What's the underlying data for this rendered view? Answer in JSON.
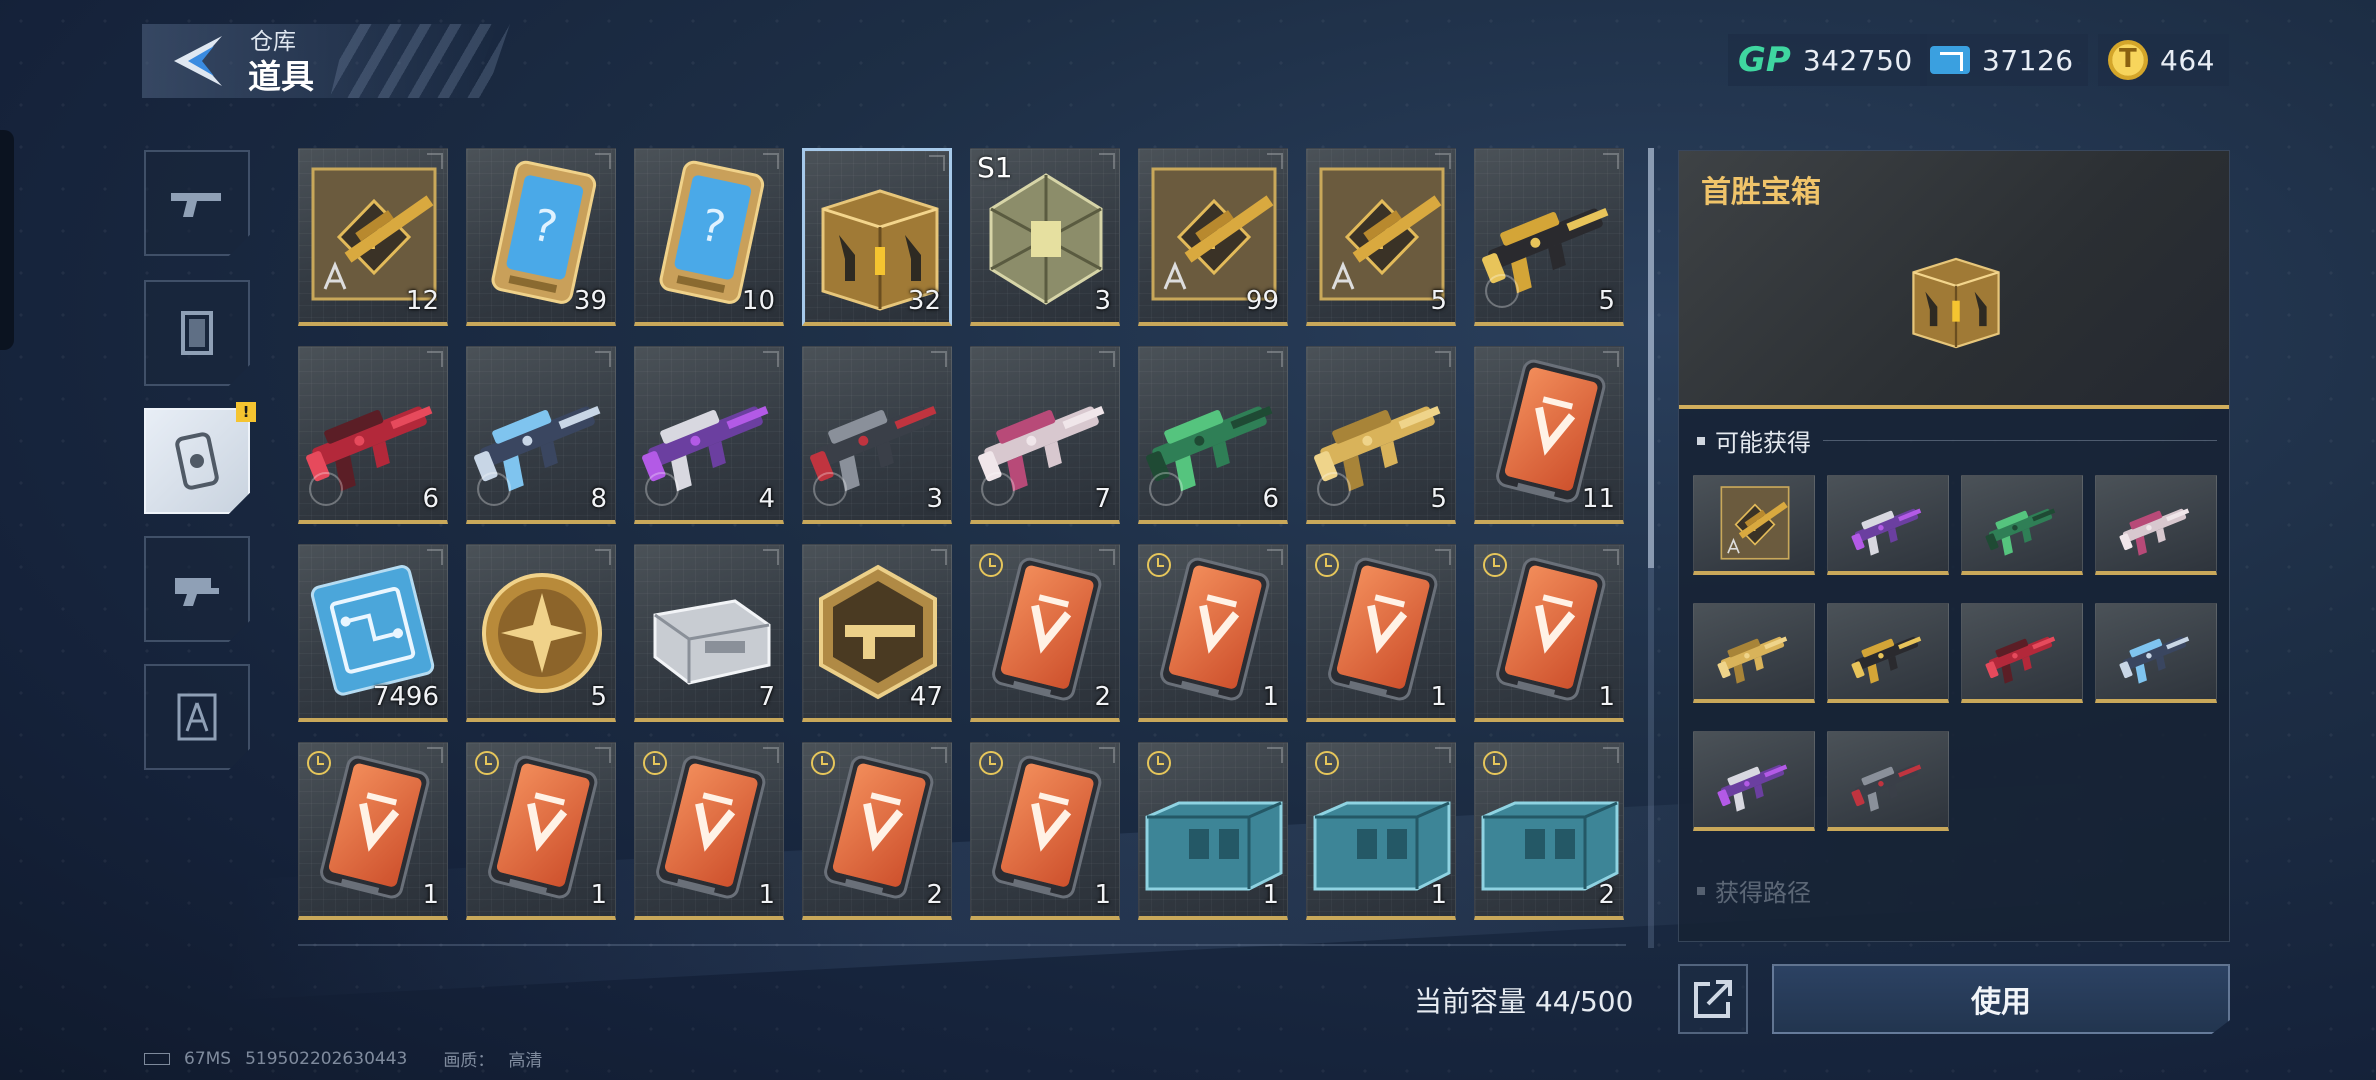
{
  "header": {
    "breadcrumb_parent": "仓库",
    "title": "道具"
  },
  "currencies": [
    {
      "icon": "gp-currency-icon",
      "label": "GP",
      "value": "342750"
    },
    {
      "icon": "ticket-currency-icon",
      "value": "37126"
    },
    {
      "icon": "gold-coin-icon",
      "value": "464"
    }
  ],
  "categories": [
    {
      "name": "weapons",
      "icon": "gun-icon",
      "active": false
    },
    {
      "name": "frames",
      "icon": "frame-icon",
      "active": false
    },
    {
      "name": "items",
      "icon": "item-card-icon",
      "active": true,
      "badge": "!"
    },
    {
      "name": "attachments",
      "icon": "gun-part-icon",
      "active": false
    },
    {
      "name": "blueprints",
      "icon": "blueprint-icon",
      "active": false
    }
  ],
  "items": [
    {
      "art": "blueprint-crate",
      "count": "12"
    },
    {
      "art": "mystery-card",
      "count": "39"
    },
    {
      "art": "mystery-card",
      "count": "10"
    },
    {
      "art": "gold-chest",
      "count": "32",
      "selected": true
    },
    {
      "art": "season-chest",
      "count": "3",
      "tag": "S1"
    },
    {
      "art": "blueprint-crate",
      "count": "99"
    },
    {
      "art": "blueprint-crate",
      "count": "5"
    },
    {
      "art": "rifle-black-gold",
      "count": "5",
      "timer_dim": true
    },
    {
      "art": "rifle-red",
      "count": "6",
      "timer_dim": true
    },
    {
      "art": "rifle-blue",
      "count": "8",
      "timer_dim": true
    },
    {
      "art": "rifle-purple",
      "count": "4",
      "timer_dim": true
    },
    {
      "art": "rifle-dark",
      "count": "3",
      "timer_dim": true
    },
    {
      "art": "rifle-pink",
      "count": "7",
      "timer_dim": true
    },
    {
      "art": "rifle-green",
      "count": "6",
      "timer_dim": true
    },
    {
      "art": "rifle-gold",
      "count": "5",
      "timer_dim": true
    },
    {
      "art": "orange-card",
      "count": "11"
    },
    {
      "art": "chip-card",
      "count": "7496"
    },
    {
      "art": "gold-medal",
      "count": "5"
    },
    {
      "art": "silver-case",
      "count": "7"
    },
    {
      "art": "hex-badge",
      "count": "47"
    },
    {
      "art": "orange-card",
      "count": "2",
      "timer": true
    },
    {
      "art": "orange-card",
      "count": "1",
      "timer": true
    },
    {
      "art": "orange-card",
      "count": "1",
      "timer": true
    },
    {
      "art": "orange-card",
      "count": "1",
      "timer": true
    },
    {
      "art": "orange-card",
      "count": "1",
      "timer": true
    },
    {
      "art": "orange-card",
      "count": "1",
      "timer": true
    },
    {
      "art": "orange-card",
      "count": "1",
      "timer": true
    },
    {
      "art": "orange-card",
      "count": "2",
      "timer": true
    },
    {
      "art": "orange-card",
      "count": "1",
      "timer": true
    },
    {
      "art": "teal-crate",
      "count": "1",
      "timer": true
    },
    {
      "art": "teal-crate",
      "count": "1",
      "timer": true
    },
    {
      "art": "teal-crate",
      "count": "2",
      "timer": true
    }
  ],
  "capacity": "当前容量 44/500",
  "detail": {
    "title": "首胜宝箱",
    "rewards_heading": "可能获得",
    "rewards": [
      "blueprint-crate",
      "rifle-purple",
      "rifle-green",
      "rifle-pink",
      "rifle-gold",
      "rifle-black-gold",
      "rifle-red",
      "rifle-blue",
      "rifle-purple",
      "rifle-dark"
    ],
    "source_heading": "获得路径"
  },
  "actions": {
    "use_label": "使用",
    "share_icon": "external-link-icon"
  },
  "status": {
    "ping": "67MS",
    "uid": "519502202630443",
    "quality_label": "画质：",
    "quality_value": "高清"
  },
  "colors": {
    "accent_gold": "#c9a85a",
    "title_gold": "#f0c46a",
    "gp_green": "#3fd6a0",
    "orange_card": "#e4683a",
    "teal_crate": "#4aa6b8"
  }
}
